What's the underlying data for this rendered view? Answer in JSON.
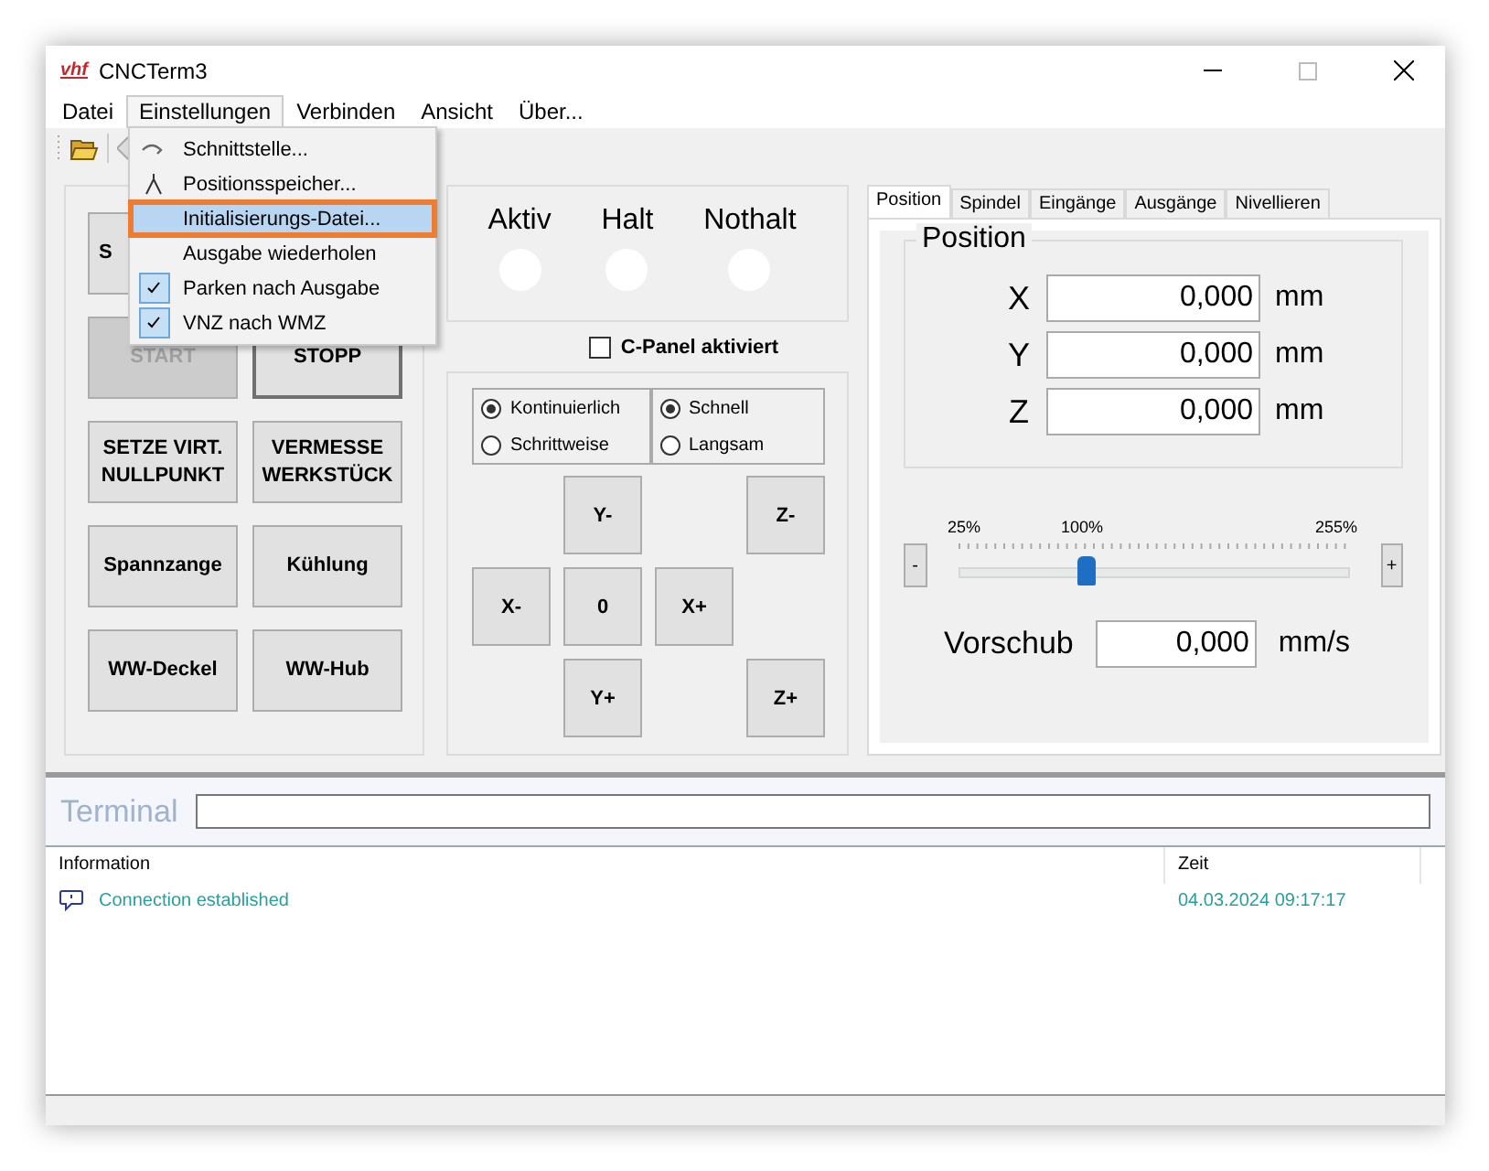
{
  "window": {
    "logo": "vhf",
    "title": "CNCTerm3"
  },
  "menu_bar": [
    {
      "label": "Datei",
      "selected": false
    },
    {
      "label": "Einstellungen",
      "selected": true
    },
    {
      "label": "Verbinden",
      "selected": false
    },
    {
      "label": "Ansicht",
      "selected": false
    },
    {
      "label": "Über...",
      "selected": false
    }
  ],
  "dropdown": [
    {
      "label": "Schnittstelle...",
      "kind": "command",
      "checked": false,
      "selected": false
    },
    {
      "label": "Positionsspeicher...",
      "kind": "command",
      "checked": false,
      "selected": false
    },
    {
      "label": "Initialisierungs-Datei...",
      "kind": "command",
      "checked": false,
      "selected": true
    },
    {
      "label": "Ausgabe wiederholen",
      "kind": "command",
      "checked": false,
      "selected": false
    },
    {
      "label": "Parken nach Ausgabe",
      "kind": "toggle",
      "checked": true,
      "selected": false
    },
    {
      "label": "VNZ nach WMZ",
      "kind": "toggle",
      "checked": true,
      "selected": false
    }
  ],
  "control_buttons": [
    {
      "label": "S",
      "disabled": false,
      "default": false
    },
    {
      "label": "START",
      "disabled": true,
      "default": false
    },
    {
      "label": "STOPP",
      "disabled": false,
      "default": true
    },
    {
      "label": "SETZE VIRT.\nNULLPUNKT",
      "disabled": false,
      "default": false
    },
    {
      "label": "VERMESSE\nWERKSTÜCK",
      "disabled": false,
      "default": false
    },
    {
      "label": "Spannzange",
      "disabled": false,
      "default": false
    },
    {
      "label": "Kühlung",
      "disabled": false,
      "default": false
    },
    {
      "label": "WW-Deckel",
      "disabled": false,
      "default": false
    },
    {
      "label": "WW-Hub",
      "disabled": false,
      "default": false
    }
  ],
  "status_lights": [
    {
      "label": "Aktiv",
      "on": false
    },
    {
      "label": "Halt",
      "on": false
    },
    {
      "label": "Nothalt",
      "on": false
    }
  ],
  "c_panel": {
    "label": "C-Panel aktiviert",
    "checked": false
  },
  "mode_options": [
    {
      "label": "Kontinuierlich",
      "selected": true
    },
    {
      "label": "Schrittweise",
      "selected": false
    }
  ],
  "speed_options": [
    {
      "label": "Schnell",
      "selected": true
    },
    {
      "label": "Langsam",
      "selected": false
    }
  ],
  "jog_buttons": [
    "Y-",
    "Z-",
    "X-",
    "0",
    "X+",
    "Y+",
    "Z+"
  ],
  "tabs": [
    {
      "label": "Position",
      "selected": true
    },
    {
      "label": "Spindel",
      "selected": false
    },
    {
      "label": "Eingänge",
      "selected": false
    },
    {
      "label": "Ausgänge",
      "selected": false
    },
    {
      "label": "Nivellieren",
      "selected": false
    }
  ],
  "position": {
    "title": "Position",
    "axes": [
      {
        "axis": "X",
        "value": "0,000",
        "unit": "mm"
      },
      {
        "axis": "Y",
        "value": "0,000",
        "unit": "mm"
      },
      {
        "axis": "Z",
        "value": "0,000",
        "unit": "mm"
      }
    ]
  },
  "override": {
    "min_label": "25%",
    "mid_label": "100%",
    "max_label": "255%",
    "level": 0.33,
    "minus": "-",
    "plus": "+"
  },
  "feed": {
    "label": "Vorschub",
    "value": "0,000",
    "unit": "mm/s"
  },
  "terminal": {
    "label": "Terminal"
  },
  "log": {
    "columns": [
      "Information",
      "Zeit"
    ],
    "rows": [
      {
        "message": "Connection established",
        "time": "04.03.2024 09:17:17"
      }
    ]
  }
}
